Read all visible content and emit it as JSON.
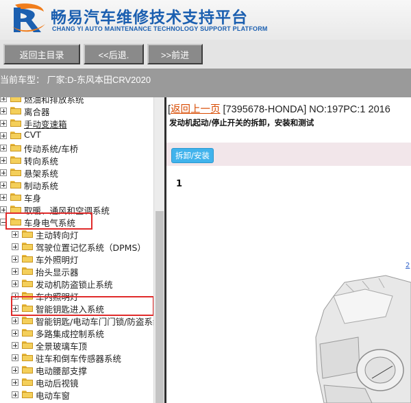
{
  "header": {
    "title": "畅易汽车维修技术支持平台",
    "subtitle": "CHANG YI AUTO MAINTENANCE TECHNOLOGY SUPPORT PLATFORM",
    "colors": {
      "brand_blue": "#1b5fb0",
      "logo_orange": "#f07d1c"
    }
  },
  "nav": {
    "home_label": "返回主目录",
    "back_label": "<<后退.",
    "forward_label": ">>前进"
  },
  "car_bar": {
    "text": "当前车型：  厂家:D-东风本田CRV2020"
  },
  "tree": {
    "rows": [
      {
        "label": "燃油和排放系统",
        "expander": "plus",
        "level": 0
      },
      {
        "label": "离合器",
        "expander": "plus",
        "level": 0
      },
      {
        "label": "手动变速箱",
        "expander": "plus",
        "level": 0
      },
      {
        "label": "CVT",
        "expander": "plus",
        "level": 0
      },
      {
        "label": "传动系统/车桥",
        "expander": "plus",
        "level": 0
      },
      {
        "label": "转向系统",
        "expander": "plus",
        "level": 0
      },
      {
        "label": "悬架系统",
        "expander": "plus",
        "level": 0
      },
      {
        "label": "制动系统",
        "expander": "plus",
        "level": 0
      },
      {
        "label": "车身",
        "expander": "plus",
        "level": 0
      },
      {
        "label": "取暖、通风和空调系统",
        "expander": "plus",
        "level": 0
      },
      {
        "label": "车身电气系统",
        "expander": "minus",
        "level": 0,
        "highlighted": true
      },
      {
        "label": "主动转向灯",
        "expander": "plus",
        "level": 1
      },
      {
        "label": "驾驶位置记忆系统（DPMS）",
        "expander": "plus",
        "level": 1
      },
      {
        "label": "车外照明灯",
        "expander": "plus",
        "level": 1
      },
      {
        "label": "抬头显示器",
        "expander": "plus",
        "level": 1
      },
      {
        "label": "发动机防盗锁止系统",
        "expander": "plus",
        "level": 1
      },
      {
        "label": "车内照明灯",
        "expander": "plus",
        "level": 1
      },
      {
        "label": "智能钥匙进入系统",
        "expander": "plus",
        "level": 1,
        "highlighted": true
      },
      {
        "label": "智能钥匙/电动车门门锁/防盗系统",
        "expander": "plus",
        "level": 1
      },
      {
        "label": "多路集成控制系统",
        "expander": "plus",
        "level": 1
      },
      {
        "label": "全景玻璃车顶",
        "expander": "plus",
        "level": 1
      },
      {
        "label": "驻车和倒车传感器系统",
        "expander": "plus",
        "level": 1
      },
      {
        "label": "电动腰部支撑",
        "expander": "plus",
        "level": 1
      },
      {
        "label": "电动后视镜",
        "expander": "plus",
        "level": 1
      },
      {
        "label": "电动车窗",
        "expander": "plus",
        "level": 1
      }
    ],
    "highlight_color": "#e02a2a"
  },
  "content": {
    "back_link": "返回上一页",
    "doc_ref": " [7395678-HONDA] NO:197PC:1 2016",
    "doc_subtitle": "发动机起动/停止开关的拆卸，安装和测试",
    "tab_chip": "拆卸/安装",
    "step_number": "1",
    "callout": "2"
  }
}
